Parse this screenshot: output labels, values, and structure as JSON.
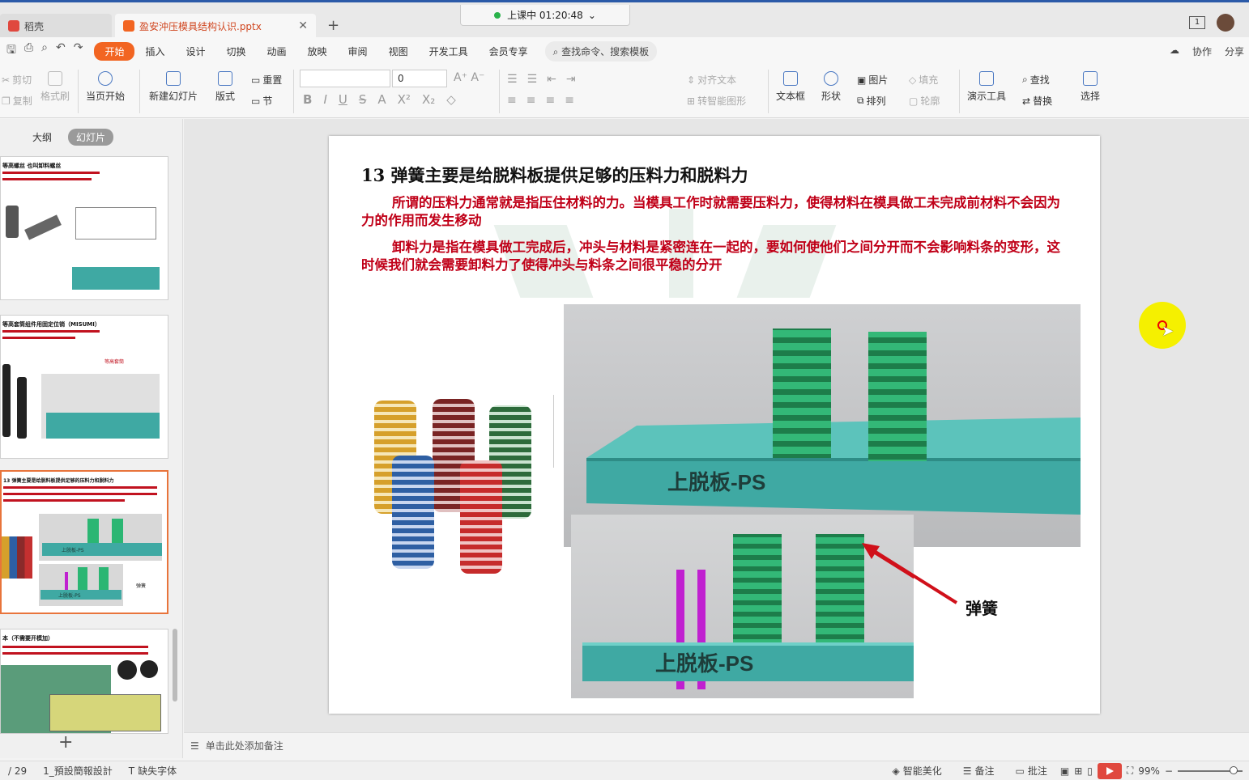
{
  "tabs": {
    "home": "稻壳",
    "document": "盈安沖压模具结构认识.pptx",
    "new_tab": "+"
  },
  "timer": {
    "text": "上课中 01:20:48"
  },
  "window": {
    "page_badge": "1"
  },
  "menu": {
    "items": [
      "开始",
      "插入",
      "设计",
      "切换",
      "动画",
      "放映",
      "审阅",
      "视图",
      "开发工具",
      "会员专享"
    ],
    "search": "查找命令、搜索模板",
    "right": [
      "协作",
      "分享"
    ]
  },
  "ribbon": {
    "cut": "剪切",
    "copy": "复制",
    "format_painter": "格式刷",
    "play_current": "当页开始",
    "new_slide": "新建幻灯片",
    "layout": "版式",
    "reset": "重置",
    "section": "节",
    "font_size": "0",
    "align_text": "对齐文本",
    "smartart": "转智能图形",
    "textbox": "文本框",
    "shape": "形状",
    "picture": "图片",
    "arrange": "排列",
    "fill": "填充",
    "outline": "轮廓",
    "presentation_tools": "演示工具",
    "find": "查找",
    "replace": "替换",
    "select": "选择"
  },
  "left_panel": {
    "tab_outline": "大纲",
    "tab_slides": "幻灯片",
    "add_slide": "+"
  },
  "thumbnails": [
    {
      "title": "等高螺丝 也叫卸料螺丝"
    },
    {
      "title": "等高套筒组件用固定位销（MISUMI）",
      "callout": "等高套筒"
    },
    {
      "title": "13 弹簧主要是给脱料板提供足够的压料力和脱料力",
      "label_top": "上脱板-PS",
      "label_bottom": "上脱板-PS",
      "callout": "弹簧"
    },
    {
      "title": "本（不需要开模加）"
    }
  ],
  "slide": {
    "title": "13 弹簧主要是给脱料板提供足够的压料力和脱料力",
    "para1": "所谓的压料力通常就是指压住材料的力。当模具工作时就需要压料力，使得材料在模具做工未完成前材料不会因为力的作用而发生移动",
    "para2": "卸料力是指在模具做工完成后，冲头与材料是紧密连在一起的，要如何使他们之间分开而不会影响料条的变形，这时候我们就会需要卸料力了使得冲头与料条之间很平稳的分开",
    "plate_label_top": "上脱板-PS",
    "plate_label_bottom": "上脱板-PS",
    "callout": "弹簧"
  },
  "notes": {
    "placeholder": "单击此处添加备注"
  },
  "status": {
    "page": "/ 29",
    "design": "1_預設簡報設計",
    "missing_font": "缺失字体",
    "beautify": "智能美化",
    "notes": "备注",
    "comment": "批注",
    "zoom": "99%"
  },
  "colors": {
    "accent": "#f26522",
    "title_red": "#c00018",
    "plate_teal": "#3fa9a3",
    "spring_green": "#2bb673"
  }
}
